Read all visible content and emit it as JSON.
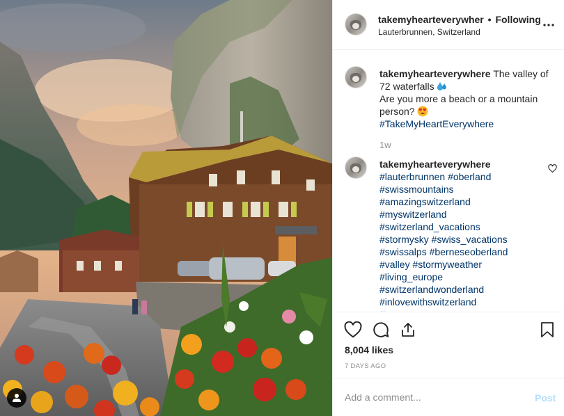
{
  "post": {
    "username": "takemyhearteverywher",
    "dot": "•",
    "follow_status": "Following",
    "location": "Lauterbrunnen, Switzerland"
  },
  "caption": {
    "username": "takemyhearteverywhere",
    "line1": "The valley of",
    "line2": "72 waterfalls",
    "line3": "Are you more a beach or a mountain",
    "line4": "person?",
    "hashtag": "#TakeMyHeartEverywhere",
    "time": "1w"
  },
  "comment": {
    "username": "takemyhearteverywhere",
    "lines": [
      "#lauterbrunnen #oberland",
      "#swissmountains",
      "#amazingswitzerland",
      "#myswitzerland",
      "#switzerland_vacations",
      "#stormysky #swiss_vacations",
      "#swissalps #berneseoberland",
      "#valley #stormyweather",
      "#living_europe",
      "#switzerlandwonderland",
      "#inlovewithswitzerland",
      "#..."
    ]
  },
  "engagement": {
    "likes": "8,004 likes",
    "date": "7 DAYS AGO"
  },
  "comment_box": {
    "placeholder": "Add a comment...",
    "post_label": "Post"
  },
  "colors": {
    "link": "#003569",
    "muted": "#8e8e8e",
    "post_disabled": "#b2dffc",
    "border": "#efefef"
  },
  "icons": [
    "more-options-icon",
    "heart-icon",
    "comment-icon",
    "share-icon",
    "bookmark-icon",
    "tagged-user-icon",
    "water-drops-emoji",
    "heart-eyes-emoji"
  ]
}
